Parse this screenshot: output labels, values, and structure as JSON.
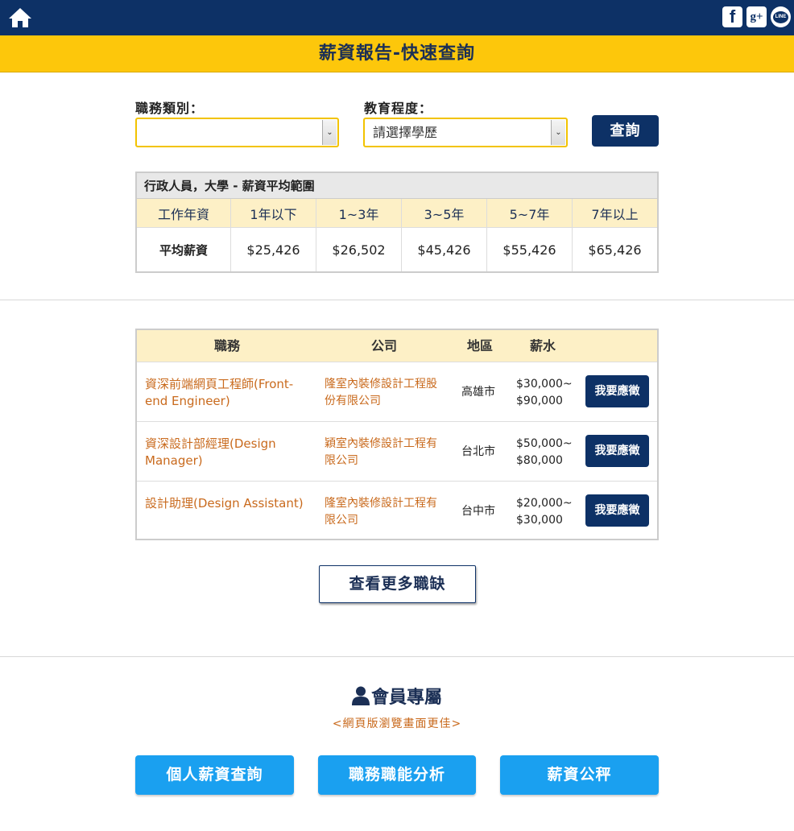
{
  "header": {
    "home_icon": "home-icon",
    "social": [
      {
        "name": "facebook",
        "glyph": "f"
      },
      {
        "name": "google-plus",
        "glyph": "g+"
      },
      {
        "name": "line",
        "glyph": "LINE"
      }
    ]
  },
  "page_title": "薪資報告-快速查詢",
  "search": {
    "category_label": "職務類別：",
    "category_value": "",
    "education_label": "教育程度：",
    "education_value": "請選擇學歷",
    "query_button": "查詢"
  },
  "range_table": {
    "caption": "行政人員，大學 - 薪資平均範圍",
    "headers": [
      "工作年資",
      "1年以下",
      "1~3年",
      "3~5年",
      "5~7年",
      "7年以上"
    ],
    "row_label": "平均薪資",
    "values": [
      "$25,426",
      "$26,502",
      "$45,426",
      "$55,426",
      "$65,426"
    ]
  },
  "jobs": {
    "headers": {
      "title": "職務",
      "company": "公司",
      "area": "地區",
      "salary": "薪水"
    },
    "rows": [
      {
        "title": "資深前端網頁工程師(Front-end Engineer)",
        "company": "隆室內裝修設計工程股份有限公司",
        "area": "高雄市",
        "salary_min": "$30,000~",
        "salary_max": "$90,000",
        "apply": "我要應徵"
      },
      {
        "title": "資深設計部經理(Design Manager)",
        "company": "穎室內裝修設計工程有限公司",
        "area": "台北市",
        "salary_min": "$50,000~",
        "salary_max": "$80,000",
        "apply": "我要應徵"
      },
      {
        "title": "設計助理(Design Assistant)",
        "company": "隆室內裝修設計工程有限公司",
        "area": "台中市",
        "salary_min": "$20,000~",
        "salary_max": "$30,000",
        "apply": "我要應徵"
      }
    ],
    "more_button": "查看更多職缺"
  },
  "member": {
    "icon": "user-icon",
    "title": "會員專屬",
    "subtitle": "<網頁版瀏覽畫面更佳>",
    "buttons": [
      "個人薪資查詢",
      "職務職能分析",
      "薪資公秤"
    ]
  },
  "colors": {
    "navy": "#0d3166",
    "yellow": "#fdc70b",
    "cream": "#fdf0c6",
    "link_orange": "#c96a1d",
    "sky_blue": "#1aa0f0"
  }
}
